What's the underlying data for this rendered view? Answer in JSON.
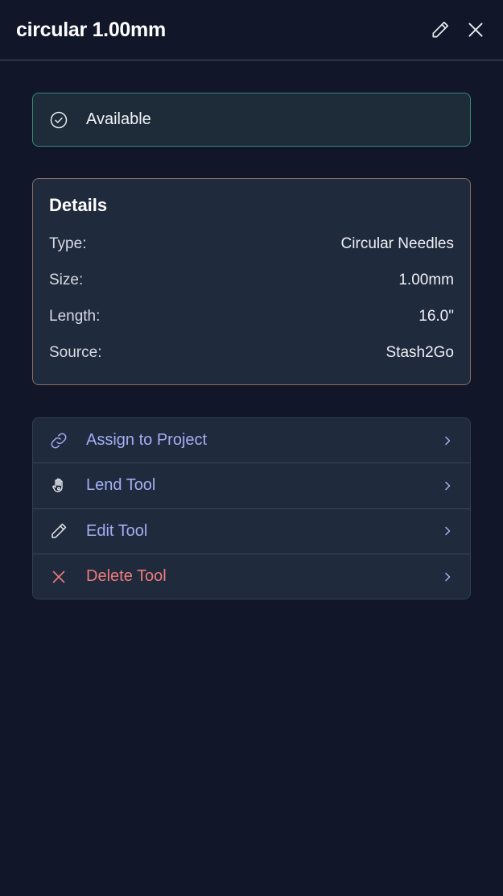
{
  "header": {
    "title": "circular 1.00mm",
    "edit_icon": "pencil-icon",
    "close_icon": "close-icon"
  },
  "status": {
    "icon": "check-circle-icon",
    "label": "Available",
    "border_color": "#3a8a73"
  },
  "details": {
    "heading": "Details",
    "rows": [
      {
        "key": "Type:",
        "value": "Circular Needles"
      },
      {
        "key": "Size:",
        "value": "1.00mm"
      },
      {
        "key": "Length:",
        "value": "16.0\""
      },
      {
        "key": "Source:",
        "value": "Stash2Go"
      }
    ]
  },
  "actions": [
    {
      "label": "Assign to Project",
      "icon": "link-icon",
      "color": "#a3aef3"
    },
    {
      "label": "Lend Tool",
      "icon": "hand-icon",
      "color": "#a3aef3"
    },
    {
      "label": "Edit Tool",
      "icon": "pencil-icon",
      "color": "#a3aef3"
    },
    {
      "label": "Delete Tool",
      "icon": "close-icon",
      "color": "#ec7b7b"
    }
  ]
}
